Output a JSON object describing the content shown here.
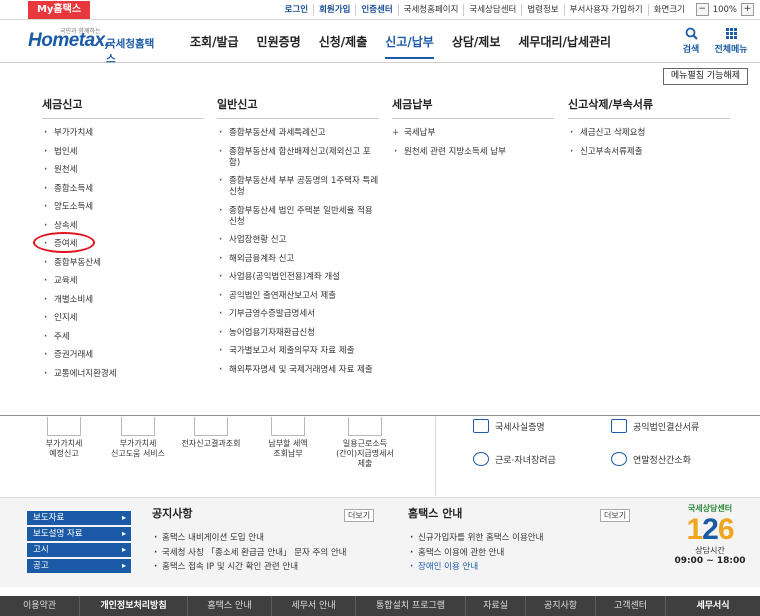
{
  "topbar": {
    "my_hometax": "My홈택스",
    "links": [
      "로그인",
      "회원가입",
      "인증센터",
      "국세청홈페이지",
      "국세상담센터",
      "법령정보",
      "부서사용자 가입하기",
      "화면크기"
    ],
    "zoom_minus": "−",
    "zoom_value": "100%",
    "zoom_plus": "+"
  },
  "header": {
    "logo_tagline": "국민과 함께하는",
    "logo_brand": "Hometax,",
    "logo_sub": "국세청홈택스",
    "gnb": [
      "조회/발급",
      "민원증명",
      "신청/제출",
      "신고/납부",
      "상담/제보",
      "세무대리/납세관리"
    ],
    "active_gnb": "신고/납부",
    "search_label": "검색",
    "allmenu_label": "전체메뉴"
  },
  "mega_menu": {
    "edit_button": "메뉴펼침 기능해제",
    "columns": [
      {
        "title": "세금신고",
        "items": [
          "부가가치세",
          "법인세",
          "원천세",
          "종합소득세",
          "양도소득세",
          "상속세",
          "증여세",
          "종합부동산세",
          "교육세",
          "개별소비세",
          "인지세",
          "주세",
          "증권거래세",
          "교통에너지환경세"
        ]
      },
      {
        "title": "일반신고",
        "items": [
          "종합부동산세 과세특례신고",
          "종합부동산세 합산배제신고(제외신고 포함)",
          "종합부동산세 부부 공동명의 1주택자 특례 신청",
          "종합부동산세 법인 주택분 일반세율 적용 신청",
          "사업장현황 신고",
          "해외금융계좌 신고",
          "사업용(공익법인전용)계좌 개설",
          "공익법인 출연재산보고서 제출",
          "기부금영수증발급명세서",
          "농어업용기자재환급신청",
          "국가별보고서 제출의무자 자료 제출",
          "해외투자명세 및 국제거래명세 자료 제출"
        ]
      },
      {
        "title": "세금납부",
        "items": [
          "국세납부",
          "원천세 관련 지방소득세 납부"
        ]
      },
      {
        "title": "신고삭제/부속서류",
        "items": [
          "세금신고 삭제요청",
          "신고부속서류제출"
        ]
      }
    ]
  },
  "quick_icons": [
    "부가가치세\n예정신고",
    "부가가치세\n신고도움 서비스",
    "전자신고결과조회",
    "납부할 세액\n조회납부",
    "일용근로소득\n(간이)지급명세서\n제출"
  ],
  "quick_links": [
    "국세사실증명",
    "공익법인결산서류",
    "근로·자녀장려금",
    "연말정산간소화"
  ],
  "bottom_nav": [
    "보도자료",
    "보도설명 자료",
    "고시",
    "공고"
  ],
  "notice_board": {
    "title": "공지사항",
    "more": "더보기",
    "items": [
      "홈택스 내비게이션 도입 안내",
      "국세청 사칭 「종소세 환급금 안내」 문자 주의 안내",
      "홈택스 접속 IP 및 시간 확인 관련 안내"
    ]
  },
  "hometax_board": {
    "title": "홈택스 안내",
    "more": "더보기",
    "items": [
      "신규가입자를 위한 홈택스 이용안내",
      "홈택스 이용에 관한 안내",
      "장애인 이용 안내"
    ]
  },
  "callcenter": {
    "title": "국세상담센터",
    "number_a": "1",
    "number_b": "2",
    "number_c": "6",
    "hours_label": "상담시간",
    "hours": "09:00 ~ 18:00"
  },
  "footer": [
    "이용약관",
    "개인정보처리방침",
    "홈택스 안내",
    "세무서 안내",
    "통합설치 프로그램",
    "자료실",
    "공지사항",
    "고객센터",
    "세무서식"
  ]
}
